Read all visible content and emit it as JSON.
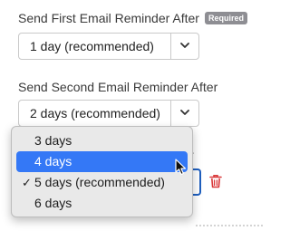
{
  "first_reminder": {
    "label": "Send First Email Reminder After",
    "badge": "Required",
    "value": "1 day (recommended)"
  },
  "second_reminder": {
    "label": "Send Second Email Reminder After",
    "value": "2 days (recommended)"
  },
  "third_reminder": {
    "label_fragment": "r"
  },
  "dropdown": {
    "options": [
      {
        "label": "3 days"
      },
      {
        "label": "4 days"
      },
      {
        "label": "5 days (recommended)",
        "check": "✓"
      },
      {
        "label": "6 days"
      }
    ]
  },
  "colors": {
    "highlight": "#3478f6",
    "focus_border": "#1f5fbf",
    "delete": "#d9383a",
    "badge": "#8e8e93"
  },
  "icons": [
    "chevron-down-icon",
    "trash-icon",
    "checkmark-icon",
    "mouse-pointer-icon"
  ]
}
